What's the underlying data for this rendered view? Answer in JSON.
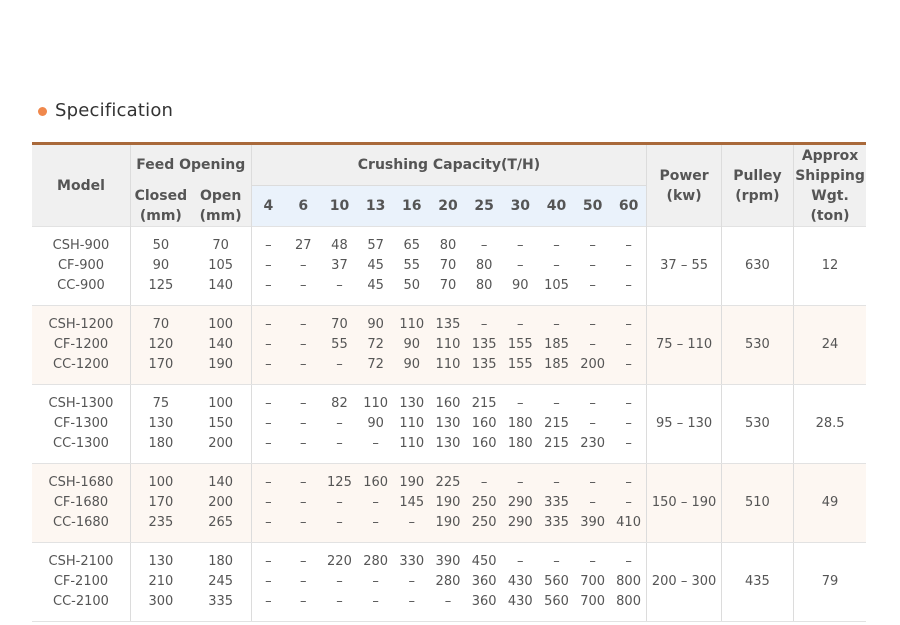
{
  "section": {
    "title": "Specification"
  },
  "colors": {
    "bullet": "#f0884c",
    "rule": "#a9693a",
    "header_gray": "#f0f0f0",
    "header_blue": "#eaf2fb",
    "row_alt": "#fdf7f2"
  },
  "headers": {
    "model": "Model",
    "feed_opening": "Feed Opening",
    "crushing_capacity": "Crushing Capacity(T/H)",
    "power": [
      "Power",
      "(kw)"
    ],
    "pulley": [
      "Pulley",
      "(rpm)"
    ],
    "shipping": [
      "Approx",
      "Shipping",
      "Wgt.(ton)"
    ],
    "closed": [
      "Closed",
      "(mm)"
    ],
    "open": [
      "Open",
      "(mm)"
    ],
    "capacity_sizes": [
      "4",
      "6",
      "10",
      "13",
      "16",
      "20",
      "25",
      "30",
      "40",
      "50",
      "60"
    ]
  },
  "rows": [
    {
      "models": [
        "CSH-900",
        "CF-900",
        "CC-900"
      ],
      "closed": [
        "50",
        "90",
        "125"
      ],
      "open": [
        "70",
        "105",
        "140"
      ],
      "capacity": [
        [
          "–",
          "–",
          "–"
        ],
        [
          "27",
          "–",
          "–"
        ],
        [
          "48",
          "37",
          "–"
        ],
        [
          "57",
          "45",
          "45"
        ],
        [
          "65",
          "55",
          "50"
        ],
        [
          "80",
          "70",
          "70"
        ],
        [
          "–",
          "80",
          "80"
        ],
        [
          "–",
          "–",
          "90"
        ],
        [
          "–",
          "–",
          "105"
        ],
        [
          "–",
          "–",
          "–"
        ],
        [
          "–",
          "–",
          "–"
        ]
      ],
      "power": "37 – 55",
      "pulley": "630",
      "weight": "12"
    },
    {
      "models": [
        "CSH-1200",
        "CF-1200",
        "CC-1200"
      ],
      "closed": [
        "70",
        "120",
        "170"
      ],
      "open": [
        "100",
        "140",
        "190"
      ],
      "capacity": [
        [
          "–",
          "–",
          "–"
        ],
        [
          "–",
          "–",
          "–"
        ],
        [
          "70",
          "55",
          "–"
        ],
        [
          "90",
          "72",
          "72"
        ],
        [
          "110",
          "90",
          "90"
        ],
        [
          "135",
          "110",
          "110"
        ],
        [
          "–",
          "135",
          "135"
        ],
        [
          "–",
          "155",
          "155"
        ],
        [
          "–",
          "185",
          "185"
        ],
        [
          "–",
          "–",
          "200"
        ],
        [
          "–",
          "–",
          "–"
        ]
      ],
      "power": "75 – 110",
      "pulley": "530",
      "weight": "24"
    },
    {
      "models": [
        "CSH-1300",
        "CF-1300",
        "CC-1300"
      ],
      "closed": [
        "75",
        "130",
        "180"
      ],
      "open": [
        "100",
        "150",
        "200"
      ],
      "capacity": [
        [
          "–",
          "–",
          "–"
        ],
        [
          "–",
          "–",
          "–"
        ],
        [
          "82",
          "–",
          "–"
        ],
        [
          "110",
          "90",
          "–"
        ],
        [
          "130",
          "110",
          "110"
        ],
        [
          "160",
          "130",
          "130"
        ],
        [
          "215",
          "160",
          "160"
        ],
        [
          "–",
          "180",
          "180"
        ],
        [
          "–",
          "215",
          "215"
        ],
        [
          "–",
          "–",
          "230"
        ],
        [
          "–",
          "–",
          "–"
        ]
      ],
      "power": "95 – 130",
      "pulley": "530",
      "weight": "28.5"
    },
    {
      "models": [
        "CSH-1680",
        "CF-1680",
        "CC-1680"
      ],
      "closed": [
        "100",
        "170",
        "235"
      ],
      "open": [
        "140",
        "200",
        "265"
      ],
      "capacity": [
        [
          "–",
          "–",
          "–"
        ],
        [
          "–",
          "–",
          "–"
        ],
        [
          "125",
          "–",
          "–"
        ],
        [
          "160",
          "–",
          "–"
        ],
        [
          "190",
          "145",
          "–"
        ],
        [
          "225",
          "190",
          "190"
        ],
        [
          "–",
          "250",
          "250"
        ],
        [
          "–",
          "290",
          "290"
        ],
        [
          "–",
          "335",
          "335"
        ],
        [
          "–",
          "–",
          "390"
        ],
        [
          "–",
          "–",
          "410"
        ]
      ],
      "power": "150 – 190",
      "pulley": "510",
      "weight": "49"
    },
    {
      "models": [
        "CSH-2100",
        "CF-2100",
        "CC-2100"
      ],
      "closed": [
        "130",
        "210",
        "300"
      ],
      "open": [
        "180",
        "245",
        "335"
      ],
      "capacity": [
        [
          "–",
          "–",
          "–"
        ],
        [
          "–",
          "–",
          "–"
        ],
        [
          "220",
          "–",
          "–"
        ],
        [
          "280",
          "–",
          "–"
        ],
        [
          "330",
          "–",
          "–"
        ],
        [
          "390",
          "280",
          "–"
        ],
        [
          "450",
          "360",
          "360"
        ],
        [
          "–",
          "430",
          "430"
        ],
        [
          "–",
          "560",
          "560"
        ],
        [
          "–",
          "700",
          "700"
        ],
        [
          "–",
          "800",
          "800"
        ]
      ],
      "power": "200 – 300",
      "pulley": "435",
      "weight": "79"
    }
  ]
}
